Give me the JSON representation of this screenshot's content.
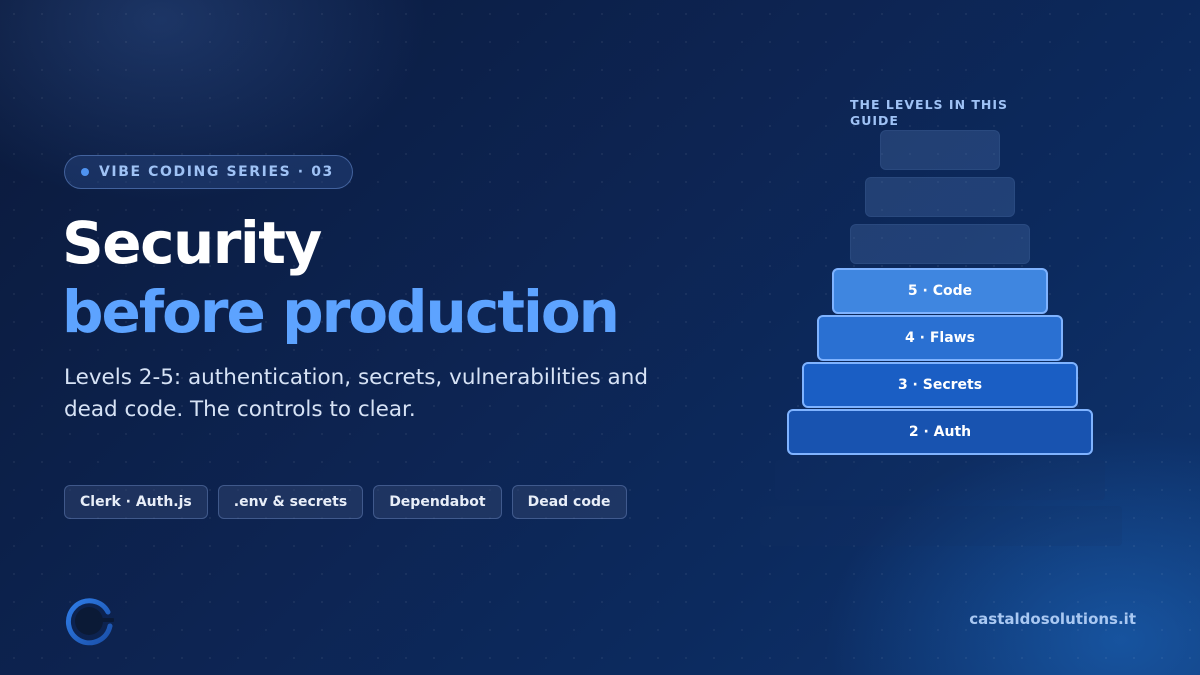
{
  "badge": {
    "text": "VIBE CODING SERIES · 03"
  },
  "title": {
    "line1": "Security",
    "line2": "before production"
  },
  "subtitle": "Levels 2-5: authentication, secrets, vulnerabilities and dead code. The controls to clear.",
  "tags": [
    "Clerk · Auth.js",
    ".env & secrets",
    "Dependabot",
    "Dead code"
  ],
  "levels": {
    "label": "THE LEVELS IN THIS GUIDE",
    "steps": [
      {
        "label": "",
        "state": "faded"
      },
      {
        "label": "",
        "state": "faded"
      },
      {
        "label": "",
        "state": "faded"
      },
      {
        "label": "5 · Code",
        "state": "active",
        "color": "#3f86e0"
      },
      {
        "label": "4 · Flaws",
        "state": "active",
        "color": "#2a70d2"
      },
      {
        "label": "3 · Secrets",
        "state": "active",
        "color": "#1a5ec4"
      },
      {
        "label": "2 · Auth",
        "state": "active",
        "color": "#1853b0"
      }
    ]
  },
  "footer": {
    "site": "castaldosolutions.it"
  },
  "colors": {
    "accent": "#5da3ff",
    "background": "#0d2452"
  }
}
